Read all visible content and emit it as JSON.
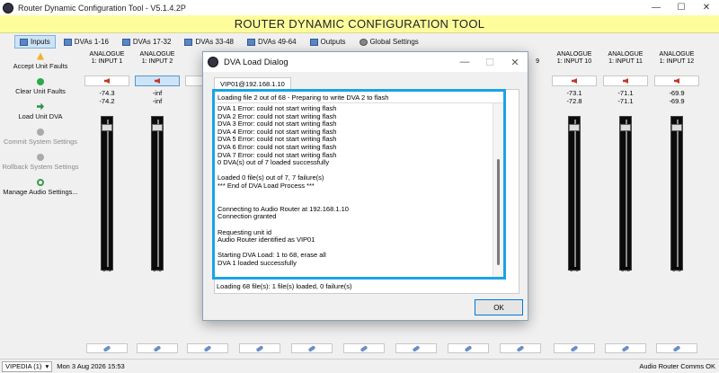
{
  "app": {
    "title": "Router Dynamic Configuration Tool - V5.1.4.2P",
    "banner": "ROUTER DYNAMIC CONFIGURATION TOOL",
    "window_controls": [
      "—",
      "☐",
      "✕"
    ]
  },
  "tabs": [
    {
      "label": "Inputs",
      "active": true
    },
    {
      "label": "DVAs 1-16"
    },
    {
      "label": "DVAs 17-32"
    },
    {
      "label": "DVAs 33-48"
    },
    {
      "label": "DVAs 49-64"
    },
    {
      "label": "Outputs"
    },
    {
      "label": "Global Settings"
    }
  ],
  "actions": [
    {
      "label": "Accept Unit Faults",
      "icon": "warning-icon",
      "enabled": true
    },
    {
      "label": "Clear Unit Faults",
      "icon": "tick-icon",
      "enabled": true
    },
    {
      "label": "Load Unit DVA",
      "icon": "arrow-icon",
      "enabled": true
    },
    {
      "label": "Commit System Settings",
      "icon": "commit-icon",
      "enabled": false
    },
    {
      "label": "Rollback System Settings",
      "icon": "rollback-icon",
      "enabled": false
    },
    {
      "label": "Manage Audio Settings...",
      "icon": "refresh-icon",
      "enabled": true
    }
  ],
  "channels": [
    {
      "line1": "ANALOGUE",
      "line2": "1: INPUT 1",
      "lvl1": "-74.3",
      "lvl2": "-74.2",
      "value": "0.0",
      "selected": false
    },
    {
      "line1": "ANALOGUE",
      "line2": "1: INPUT 2",
      "lvl1": "-inf",
      "lvl2": "-inf",
      "value": "0.0",
      "selected": true
    },
    {
      "line1": "ANALOGUE",
      "line2": "1: INPUT 10",
      "lvl1": "-73.1",
      "lvl2": "-72.8",
      "value": "0.0",
      "selected": false
    },
    {
      "line1": "ANALOGUE",
      "line2": "1: INPUT 11",
      "lvl1": "-71.1",
      "lvl2": "-71.1",
      "value": "0.0",
      "selected": false
    },
    {
      "line1": "ANALOGUE",
      "line2": "1: INPUT 12",
      "lvl1": "-69.9",
      "lvl2": "-69.9",
      "value": "0.0",
      "selected": false
    }
  ],
  "hidden_strip_label": "9",
  "status": {
    "unit": "VIPEDIA (1)",
    "datetime": "Mon 3 Aug 2026 15:53",
    "comms": "Audio Router Comms OK"
  },
  "dialog": {
    "title": "DVA Load Dialog",
    "tab": "VIP01@192.168.1.10",
    "log_header": "Loading file 2 out of 68 - Preparing to write DVA 2 to flash",
    "log_lines": [
      "DVA 1 Error: could not start writing flash",
      "DVA 2 Error: could not start writing flash",
      "DVA 3 Error: could not start writing flash",
      "DVA 4 Error: could not start writing flash",
      "DVA 5 Error: could not start writing flash",
      "DVA 6 Error: could not start writing flash",
      "DVA 7 Error: could not start writing flash",
      "0 DVA(s) out of 7 loaded successfully",
      "",
      "Loaded 0 file(s) out of 7, 7 failure(s)",
      "*** End of DVA Load Process ***",
      "",
      "",
      "Connecting to Audio Router at 192.168.1.10",
      "Connection granted",
      "",
      "Requesting unit id",
      "Audio Router identified as VIP01",
      "",
      "Starting DVA Load: 1 to 68, erase all",
      "DVA 1 loaded successfully"
    ],
    "status_line": "Loading 68 file(s): 1 file(s) loaded, 0 failure(s)",
    "ok_label": "OK",
    "controls": [
      "—",
      "☐",
      "✕"
    ]
  }
}
